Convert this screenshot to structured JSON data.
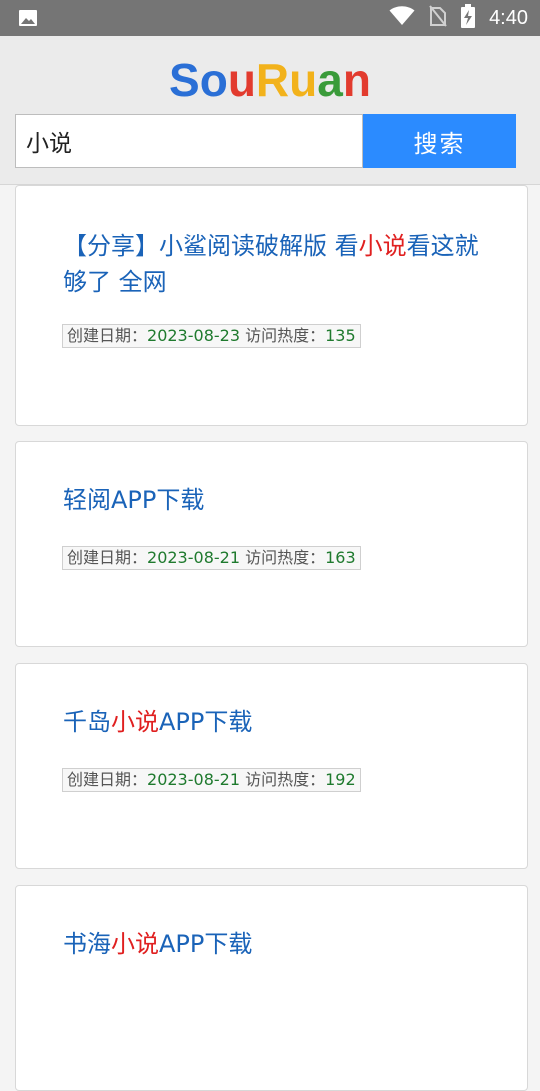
{
  "status_bar": {
    "time": "4:40",
    "icons": [
      "image-icon",
      "wifi-icon",
      "no-sim-icon",
      "battery-charging-icon"
    ]
  },
  "logo": {
    "parts": [
      {
        "text": "S",
        "color": "#2a6fd6"
      },
      {
        "text": "o",
        "color": "#2a6fd6"
      },
      {
        "text": "u",
        "color": "#e23b2e"
      },
      {
        "text": "R",
        "color": "#f2b21b"
      },
      {
        "text": "u",
        "color": "#f2b21b"
      },
      {
        "text": "a",
        "color": "#3a9b3a"
      },
      {
        "text": "n",
        "color": "#e23b2e"
      }
    ]
  },
  "search": {
    "value": "小说",
    "button_label": "搜索"
  },
  "results": [
    {
      "title_parts": [
        {
          "text": "【分享】小鲨阅读破解版 看",
          "hl": false
        },
        {
          "text": "小说",
          "hl": true
        },
        {
          "text": "看这就够了 全网",
          "hl": false
        }
      ],
      "date_label": "创建日期：",
      "date": "2023-08-23",
      "heat_label": " 访问热度：",
      "heat": "135"
    },
    {
      "title_parts": [
        {
          "text": "轻阅APP下载",
          "hl": false
        }
      ],
      "date_label": "创建日期：",
      "date": "2023-08-21",
      "heat_label": " 访问热度：",
      "heat": "163"
    },
    {
      "title_parts": [
        {
          "text": "千岛",
          "hl": false
        },
        {
          "text": "小说",
          "hl": true
        },
        {
          "text": "APP下载",
          "hl": false
        }
      ],
      "date_label": "创建日期：",
      "date": "2023-08-21",
      "heat_label": " 访问热度：",
      "heat": "192"
    },
    {
      "title_parts": [
        {
          "text": "书海",
          "hl": false
        },
        {
          "text": "小说",
          "hl": true
        },
        {
          "text": "APP下载",
          "hl": false
        }
      ]
    }
  ],
  "colors": {
    "status_bar": "#757575",
    "header_bg": "#ebebeb",
    "search_button": "#2b8bff",
    "title": "#1a63b8",
    "highlight": "#e02020",
    "meta_value": "#1f7a2e"
  }
}
